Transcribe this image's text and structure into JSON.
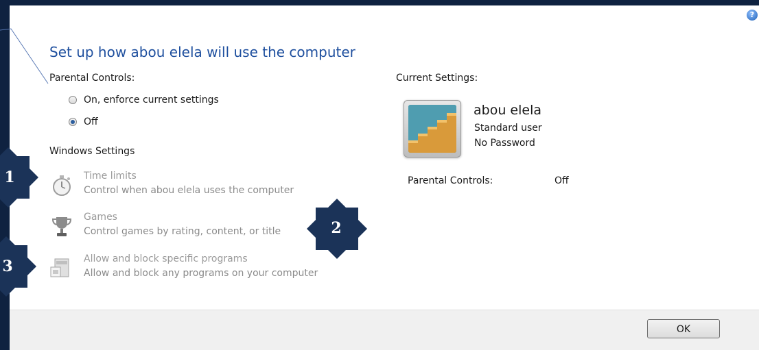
{
  "dialog": {
    "help_label": "?",
    "title": "Set up how abou elela will use the computer",
    "parental_controls": {
      "heading": "Parental Controls:",
      "options": [
        {
          "label": "On, enforce current settings",
          "selected": false
        },
        {
          "label": "Off",
          "selected": true
        }
      ]
    },
    "windows_settings": {
      "heading": "Windows Settings",
      "items": [
        {
          "icon": "stopwatch-icon",
          "title": "Time limits",
          "desc": "Control when abou elela uses the computer"
        },
        {
          "icon": "trophy-icon",
          "title": "Games",
          "desc": "Control games by rating, content, or title"
        },
        {
          "icon": "program-window-icon",
          "title": "Allow and block specific programs",
          "desc": "Allow and block any programs on your computer"
        }
      ]
    },
    "current_settings": {
      "heading": "Current Settings:",
      "user_name": "abou elela",
      "account_type": "Standard user",
      "password_status": "No Password",
      "parental_controls_label": "Parental Controls:",
      "parental_controls_value": "Off"
    },
    "ok_label": "OK"
  },
  "badges": [
    "1",
    "2",
    "3"
  ],
  "colors": {
    "background": "#0f2240",
    "title": "#1e4f9e",
    "badge": "#1b3358",
    "disabled_text": "#9a9a9a"
  }
}
